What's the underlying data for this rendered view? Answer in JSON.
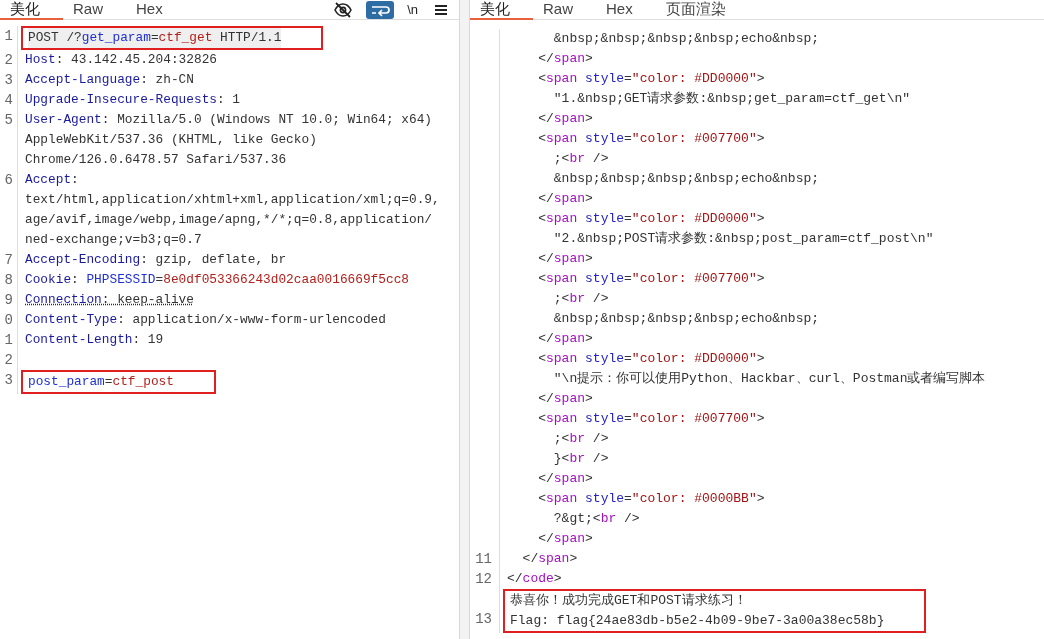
{
  "request": {
    "tabs": [
      {
        "label": "美化",
        "selected": true
      },
      {
        "label": "Raw",
        "selected": false
      },
      {
        "label": "Hex",
        "selected": false
      }
    ],
    "toolbar": {
      "wrap_on": true,
      "newline_label": "\\n"
    },
    "blocks": [
      {
        "highlighted": true,
        "lines": [
          {
            "number": "1",
            "current": true,
            "tokens": [
              {
                "kind": "plain",
                "text": "POST /?"
              },
              {
                "kind": "pname",
                "text": "get_param"
              },
              {
                "kind": "plain",
                "text": "="
              },
              {
                "kind": "pvalue",
                "text": "ctf_get"
              },
              {
                "kind": "plain",
                "text": " HTTP/1.1"
              }
            ]
          }
        ]
      },
      {
        "highlighted": false,
        "lines": [
          {
            "number": "2",
            "tokens": [
              {
                "kind": "hname",
                "text": "Host"
              },
              {
                "kind": "plain",
                "text": ": 43.142.45.204:32826"
              }
            ]
          },
          {
            "number": "3",
            "tokens": [
              {
                "kind": "hname",
                "text": "Accept-Language"
              },
              {
                "kind": "plain",
                "text": ": zh-CN"
              }
            ]
          },
          {
            "number": "4",
            "tokens": [
              {
                "kind": "hname",
                "text": "Upgrade-Insecure-Requests"
              },
              {
                "kind": "plain",
                "text": ": 1"
              }
            ]
          },
          {
            "number": "5",
            "tokens": [
              {
                "kind": "hname",
                "text": "User-Agent"
              },
              {
                "kind": "plain",
                "text": ": Mozilla/5.0 (Windows NT 10.0; Win64; x64)"
              }
            ]
          },
          {
            "tokens": [
              {
                "kind": "plain",
                "text": "AppleWebKit/537.36 (KHTML, like Gecko)"
              }
            ]
          },
          {
            "tokens": [
              {
                "kind": "plain",
                "text": "Chrome/126.0.6478.57 Safari/537.36"
              }
            ]
          },
          {
            "number": "6",
            "tokens": [
              {
                "kind": "hname",
                "text": "Accept"
              },
              {
                "kind": "plain",
                "text": ":"
              }
            ]
          },
          {
            "tokens": [
              {
                "kind": "plain",
                "text": "text/html,application/xhtml+xml,application/xml;q=0.9,"
              }
            ]
          },
          {
            "tokens": [
              {
                "kind": "plain",
                "text": "age/avif,image/webp,image/apng,*/*;q=0.8,application/"
              }
            ]
          },
          {
            "tokens": [
              {
                "kind": "plain",
                "text": "ned-exchange;v=b3;q=0.7"
              }
            ]
          },
          {
            "number": "7",
            "tokens": [
              {
                "kind": "hname",
                "text": "Accept-Encoding"
              },
              {
                "kind": "plain",
                "text": ": gzip, deflate, br"
              }
            ]
          },
          {
            "number": "8",
            "tokens": [
              {
                "kind": "hname",
                "text": "Cookie"
              },
              {
                "kind": "plain",
                "text": ": "
              },
              {
                "kind": "pname",
                "text": "PHPSESSID"
              },
              {
                "kind": "plain",
                "text": "="
              },
              {
                "kind": "pvalue",
                "text": "8e0df053366243d02caa0016669f5cc8"
              }
            ]
          },
          {
            "number": "9",
            "warning": true,
            "tokens": [
              {
                "kind": "hname",
                "text": "Connection"
              },
              {
                "kind": "plain",
                "text": ": keep-alive"
              }
            ]
          },
          {
            "number": "0",
            "tokens": [
              {
                "kind": "hname",
                "text": "Content-Type"
              },
              {
                "kind": "plain",
                "text": ": application/x-www-form-urlencoded"
              }
            ]
          },
          {
            "number": "1",
            "tokens": [
              {
                "kind": "hname",
                "text": "Content-Length"
              },
              {
                "kind": "plain",
                "text": ": 19"
              }
            ]
          },
          {
            "number": "2"
          }
        ]
      },
      {
        "highlighted": true,
        "lines": [
          {
            "number": "3",
            "tokens": [
              {
                "kind": "pname",
                "text": "post_param"
              },
              {
                "kind": "plain",
                "text": "="
              },
              {
                "kind": "pvalue",
                "text": "ctf_post"
              }
            ]
          }
        ]
      }
    ]
  },
  "response": {
    "tabs": [
      {
        "label": "美化",
        "selected": true
      },
      {
        "label": "Raw",
        "selected": false
      },
      {
        "label": "Hex",
        "selected": false
      },
      {
        "label": "页面渲染",
        "selected": false
      }
    ],
    "blocks": [
      {
        "highlighted": false,
        "lines": [
          {
            "tokens": [
              {
                "kind": "plain",
                "text": "      &nbsp;&nbsp;&nbsp;&nbsp;echo&nbsp;"
              }
            ]
          },
          {
            "tokens": [
              {
                "kind": "plain",
                "text": "    </"
              },
              {
                "kind": "tag",
                "text": "span"
              },
              {
                "kind": "plain",
                "text": ">"
              }
            ]
          },
          {
            "tokens": [
              {
                "kind": "plain",
                "text": "    <"
              },
              {
                "kind": "tag",
                "text": "span"
              },
              {
                "kind": "attr",
                "text": " style"
              },
              {
                "kind": "plain",
                "text": "="
              },
              {
                "kind": "string",
                "text": "\"color: #DD0000\""
              },
              {
                "kind": "plain",
                "text": ">"
              }
            ]
          },
          {
            "tokens": [
              {
                "kind": "plain",
                "text": "      \"1.&nbsp;GET请求参数:&nbsp;get_param=ctf_get\\n\""
              }
            ]
          },
          {
            "tokens": [
              {
                "kind": "plain",
                "text": "    </"
              },
              {
                "kind": "tag",
                "text": "span"
              },
              {
                "kind": "plain",
                "text": ">"
              }
            ]
          },
          {
            "tokens": [
              {
                "kind": "plain",
                "text": "    <"
              },
              {
                "kind": "tag",
                "text": "span"
              },
              {
                "kind": "attr",
                "text": " style"
              },
              {
                "kind": "plain",
                "text": "="
              },
              {
                "kind": "string",
                "text": "\"color: #007700\""
              },
              {
                "kind": "plain",
                "text": ">"
              }
            ]
          },
          {
            "tokens": [
              {
                "kind": "plain",
                "text": "      ;<"
              },
              {
                "kind": "tag",
                "text": "br"
              },
              {
                "kind": "plain",
                "text": " />"
              }
            ]
          },
          {
            "tokens": [
              {
                "kind": "plain",
                "text": "      &nbsp;&nbsp;&nbsp;&nbsp;echo&nbsp;"
              }
            ]
          },
          {
            "tokens": [
              {
                "kind": "plain",
                "text": "    </"
              },
              {
                "kind": "tag",
                "text": "span"
              },
              {
                "kind": "plain",
                "text": ">"
              }
            ]
          },
          {
            "tokens": [
              {
                "kind": "plain",
                "text": "    <"
              },
              {
                "kind": "tag",
                "text": "span"
              },
              {
                "kind": "attr",
                "text": " style"
              },
              {
                "kind": "plain",
                "text": "="
              },
              {
                "kind": "string",
                "text": "\"color: #DD0000\""
              },
              {
                "kind": "plain",
                "text": ">"
              }
            ]
          },
          {
            "tokens": [
              {
                "kind": "plain",
                "text": "      \"2.&nbsp;POST请求参数:&nbsp;post_param=ctf_post\\n\""
              }
            ]
          },
          {
            "tokens": [
              {
                "kind": "plain",
                "text": "    </"
              },
              {
                "kind": "tag",
                "text": "span"
              },
              {
                "kind": "plain",
                "text": ">"
              }
            ]
          },
          {
            "tokens": [
              {
                "kind": "plain",
                "text": "    <"
              },
              {
                "kind": "tag",
                "text": "span"
              },
              {
                "kind": "attr",
                "text": " style"
              },
              {
                "kind": "plain",
                "text": "="
              },
              {
                "kind": "string",
                "text": "\"color: #007700\""
              },
              {
                "kind": "plain",
                "text": ">"
              }
            ]
          },
          {
            "tokens": [
              {
                "kind": "plain",
                "text": "      ;<"
              },
              {
                "kind": "tag",
                "text": "br"
              },
              {
                "kind": "plain",
                "text": " />"
              }
            ]
          },
          {
            "tokens": [
              {
                "kind": "plain",
                "text": "      &nbsp;&nbsp;&nbsp;&nbsp;echo&nbsp;"
              }
            ]
          },
          {
            "tokens": [
              {
                "kind": "plain",
                "text": "    </"
              },
              {
                "kind": "tag",
                "text": "span"
              },
              {
                "kind": "plain",
                "text": ">"
              }
            ]
          },
          {
            "tokens": [
              {
                "kind": "plain",
                "text": "    <"
              },
              {
                "kind": "tag",
                "text": "span"
              },
              {
                "kind": "attr",
                "text": " style"
              },
              {
                "kind": "plain",
                "text": "="
              },
              {
                "kind": "string",
                "text": "\"color: #DD0000\""
              },
              {
                "kind": "plain",
                "text": ">"
              }
            ]
          },
          {
            "tokens": [
              {
                "kind": "plain",
                "text": "      \"\\n提示：你可以使用Python、Hackbar、curl、Postman或者编写脚本"
              }
            ]
          },
          {
            "tokens": [
              {
                "kind": "plain",
                "text": "    </"
              },
              {
                "kind": "tag",
                "text": "span"
              },
              {
                "kind": "plain",
                "text": ">"
              }
            ]
          },
          {
            "tokens": [
              {
                "kind": "plain",
                "text": "    <"
              },
              {
                "kind": "tag",
                "text": "span"
              },
              {
                "kind": "attr",
                "text": " style"
              },
              {
                "kind": "plain",
                "text": "="
              },
              {
                "kind": "string",
                "text": "\"color: #007700\""
              },
              {
                "kind": "plain",
                "text": ">"
              }
            ]
          },
          {
            "tokens": [
              {
                "kind": "plain",
                "text": "      ;<"
              },
              {
                "kind": "tag",
                "text": "br"
              },
              {
                "kind": "plain",
                "text": " />"
              }
            ]
          },
          {
            "tokens": [
              {
                "kind": "plain",
                "text": "      }<"
              },
              {
                "kind": "tag",
                "text": "br"
              },
              {
                "kind": "plain",
                "text": " />"
              }
            ]
          },
          {
            "tokens": [
              {
                "kind": "plain",
                "text": "    </"
              },
              {
                "kind": "tag",
                "text": "span"
              },
              {
                "kind": "plain",
                "text": ">"
              }
            ]
          },
          {
            "tokens": [
              {
                "kind": "plain",
                "text": "    <"
              },
              {
                "kind": "tag",
                "text": "span"
              },
              {
                "kind": "attr",
                "text": " style"
              },
              {
                "kind": "plain",
                "text": "="
              },
              {
                "kind": "string",
                "text": "\"color: #0000BB\""
              },
              {
                "kind": "plain",
                "text": ">"
              }
            ]
          },
          {
            "tokens": [
              {
                "kind": "plain",
                "text": "      ?&gt;<"
              },
              {
                "kind": "tag",
                "text": "br"
              },
              {
                "kind": "plain",
                "text": " />"
              }
            ]
          },
          {
            "tokens": [
              {
                "kind": "plain",
                "text": "    </"
              },
              {
                "kind": "tag",
                "text": "span"
              },
              {
                "kind": "plain",
                "text": ">"
              }
            ]
          },
          {
            "number": "11",
            "tokens": [
              {
                "kind": "plain",
                "text": "  </"
              },
              {
                "kind": "tag",
                "text": "span"
              },
              {
                "kind": "plain",
                "text": ">"
              }
            ]
          },
          {
            "number": "12",
            "tokens": [
              {
                "kind": "plain",
                "text": "</"
              },
              {
                "kind": "tag",
                "text": "code"
              },
              {
                "kind": "plain",
                "text": ">"
              }
            ]
          }
        ]
      },
      {
        "highlighted": true,
        "lines": [
          {
            "tokens": [
              {
                "kind": "plain",
                "text": "恭喜你！成功完成GET和POST请求练习！"
              }
            ]
          },
          {
            "number": "13",
            "tokens": [
              {
                "kind": "plain",
                "text": "Flag: flag{24ae83db-b5e2-4b09-9be7-3a00a38ec58b}"
              }
            ]
          }
        ]
      }
    ]
  }
}
